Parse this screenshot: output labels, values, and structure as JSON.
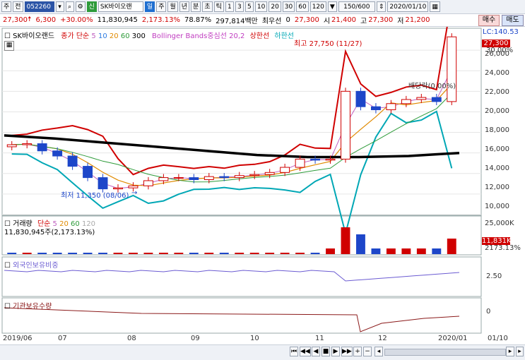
{
  "toolbar": {
    "period_prefix": "주",
    "prev_label": "전",
    "code": "052260",
    "stock_name": "SK바이오랜",
    "chip": "신",
    "periods": [
      "일",
      "주",
      "월",
      "년",
      "분",
      "초",
      "틱"
    ],
    "ticks": [
      "1",
      "3",
      "5",
      "10",
      "20",
      "30",
      "60",
      "120"
    ],
    "count": "150/600",
    "date": "2020/01/10"
  },
  "quote": {
    "price": "27,300",
    "change": "6,300",
    "change_pct": "+30.00%",
    "volume": "11,830,945",
    "vol_ratio": "2,173.13%",
    "turnover": "78.87%",
    "amount": "297,814백만",
    "pref_label": "최우선",
    "pref_value": "0",
    "close": "27,300",
    "open_label": "시",
    "open": "21,400",
    "high_label": "고",
    "high": "27,300",
    "low_label": "저",
    "low": "21,200",
    "buy": "매수",
    "sell": "매도"
  },
  "price_legend": {
    "name": "SK바이오랜드",
    "ma_label": "종가 단순",
    "ma": [
      "5",
      "10",
      "20",
      "60",
      "300"
    ],
    "bb": "Bollinger Bands중심선 20,2",
    "upper": "상한선",
    "lower": "하한선"
  },
  "annotations": {
    "high": "최고 27,750 (11/27)",
    "low": "최저 11,350 (08/06)",
    "dividend": "배당락(0.00%)"
  },
  "price_axis": {
    "lc": "LC:140.53",
    "current": "27,300",
    "pct": "30.00%",
    "ticks": [
      "26,000",
      "24,000",
      "22,000",
      "20,000",
      "18,000",
      "16,000",
      "14,000",
      "12,000",
      "10,000"
    ]
  },
  "volume_legend": {
    "name": "거래량",
    "ma_label": "단순",
    "ma": [
      "5",
      "20",
      "60",
      "120"
    ],
    "value": "11,830,945주(2,173.13%)",
    "axis_top": "25,000K",
    "current": "11,831K",
    "current_pct": "2173.13%"
  },
  "foreign": {
    "name": "외국인보유비중",
    "axis": "2.50"
  },
  "inst": {
    "name": "기관보유수량",
    "axis": "0"
  },
  "x_axis": [
    "2019/06",
    "07",
    "08",
    "09",
    "10",
    "11",
    "12",
    "2020/01",
    "01/10"
  ],
  "colors": {
    "up": "#d00000",
    "down": "#1d46c9",
    "bb": "#00a7b5",
    "ma300": "#000000"
  },
  "chart_data": {
    "type": "candlestick",
    "x": [
      "2019/06",
      "07",
      "08",
      "09",
      "10",
      "11",
      "12",
      "2020/01"
    ],
    "price_ylim": [
      10000,
      28000
    ],
    "weekly_close_approx": [
      16800,
      16900,
      16200,
      15700,
      14700,
      13600,
      12500,
      12600,
      12800,
      13300,
      13600,
      13600,
      13400,
      13700,
      13600,
      13800,
      13900,
      14100,
      14600,
      15400,
      15300,
      15400,
      22000,
      20500,
      20200,
      20800,
      21200,
      21400,
      21000,
      27300
    ],
    "high": {
      "value": 27750,
      "date": "11/27"
    },
    "low": {
      "value": 11350,
      "date": "08/06"
    },
    "ma300_approx": [
      17700,
      17400,
      17000,
      16600,
      16200,
      15800,
      15600,
      15600,
      15700,
      16000
    ]
  }
}
